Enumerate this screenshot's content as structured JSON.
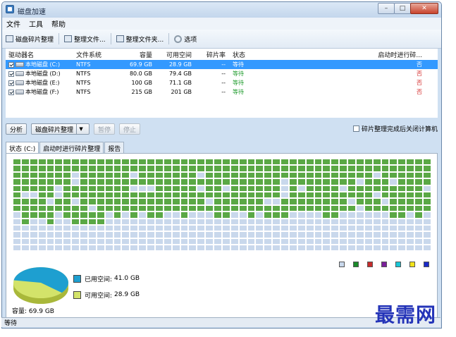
{
  "window": {
    "title": "磁盘加速"
  },
  "menu": [
    "文件",
    "工具",
    "帮助"
  ],
  "toolbar": [
    "磁盘碎片整理",
    "整理文件...",
    "整理文件夹...",
    "选项"
  ],
  "columns": [
    "驱动器名",
    "文件系统",
    "容量",
    "可用空间",
    "碎片率",
    "状态",
    "启动时进行碎..."
  ],
  "drives": [
    {
      "name": "本地磁盘 (C:)",
      "fs": "NTFS",
      "cap": "69.9 GB",
      "free": "28.9 GB",
      "frag": "--",
      "status": "等待",
      "boot": "否"
    },
    {
      "name": "本地磁盘 (D:)",
      "fs": "NTFS",
      "cap": "80.0 GB",
      "free": "79.4 GB",
      "frag": "--",
      "status": "等待",
      "boot": "否"
    },
    {
      "name": "本地磁盘 (E:)",
      "fs": "NTFS",
      "cap": "100 GB",
      "free": "71.1 GB",
      "frag": "--",
      "status": "等待",
      "boot": "否"
    },
    {
      "name": "本地磁盘 (F:)",
      "fs": "NTFS",
      "cap": "215 GB",
      "free": "201 GB",
      "frag": "--",
      "status": "等待",
      "boot": "否"
    }
  ],
  "actions": {
    "analyze": "分析",
    "defrag": "磁盘碎片整理",
    "pause": "暂停",
    "stop": "停止",
    "shutdown_after": "碎片整理完成后关闭计算机"
  },
  "tabs": [
    "状态 (C:)",
    "启动时进行碎片整理",
    "报告"
  ],
  "legend_colors": [
    "#c9d8ec",
    "#1a8a2a",
    "#c62c2c",
    "#7a1f9a",
    "#19c6d6",
    "#f2e31a",
    "#1a2ac8"
  ],
  "colors": {
    "used": "#5aa845",
    "free": "#c9d8ec",
    "pie_used": "#1e9fd0",
    "pie_free": "#d3e36a"
  },
  "usage": {
    "used_label": "已用空间:",
    "used": "41.0 GB",
    "free_label": "可用空间:",
    "free": "28.9 GB",
    "used_fraction": 0.587
  },
  "capacity": {
    "label": "容量:",
    "value": "69.9 GB"
  },
  "statusbar": "等待",
  "watermark": "最需网"
}
